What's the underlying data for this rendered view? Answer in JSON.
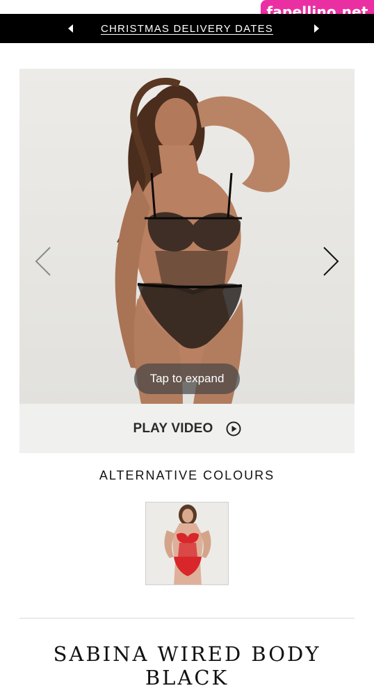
{
  "watermark": {
    "text": "fapellino.net"
  },
  "promo": {
    "link_text": "CHRISTMAS DELIVERY DATES",
    "prev_icon": "caret-left-icon",
    "next_icon": "caret-right-icon"
  },
  "gallery": {
    "prev_icon": "chevron-left-icon",
    "next_icon": "chevron-right-icon",
    "expand_label": "Tap to expand",
    "image_subject": "model wearing black sheer wired bodysuit"
  },
  "video": {
    "label": "PLAY VIDEO",
    "icon": "play-circle-icon"
  },
  "alternatives": {
    "heading": "ALTERNATIVE COLOURS",
    "swatches": [
      {
        "colour": "red",
        "image_subject": "model wearing red wired bodysuit"
      }
    ]
  },
  "product": {
    "title_line1": "SABINA WIRED BODY",
    "title_line2": "BLACK"
  },
  "colors": {
    "promo_bg": "#000000",
    "watermark_bg": "#ea2fa3",
    "play_bar_bg": "#f0f0ef",
    "gallery_bg": "#e8e7e3"
  }
}
